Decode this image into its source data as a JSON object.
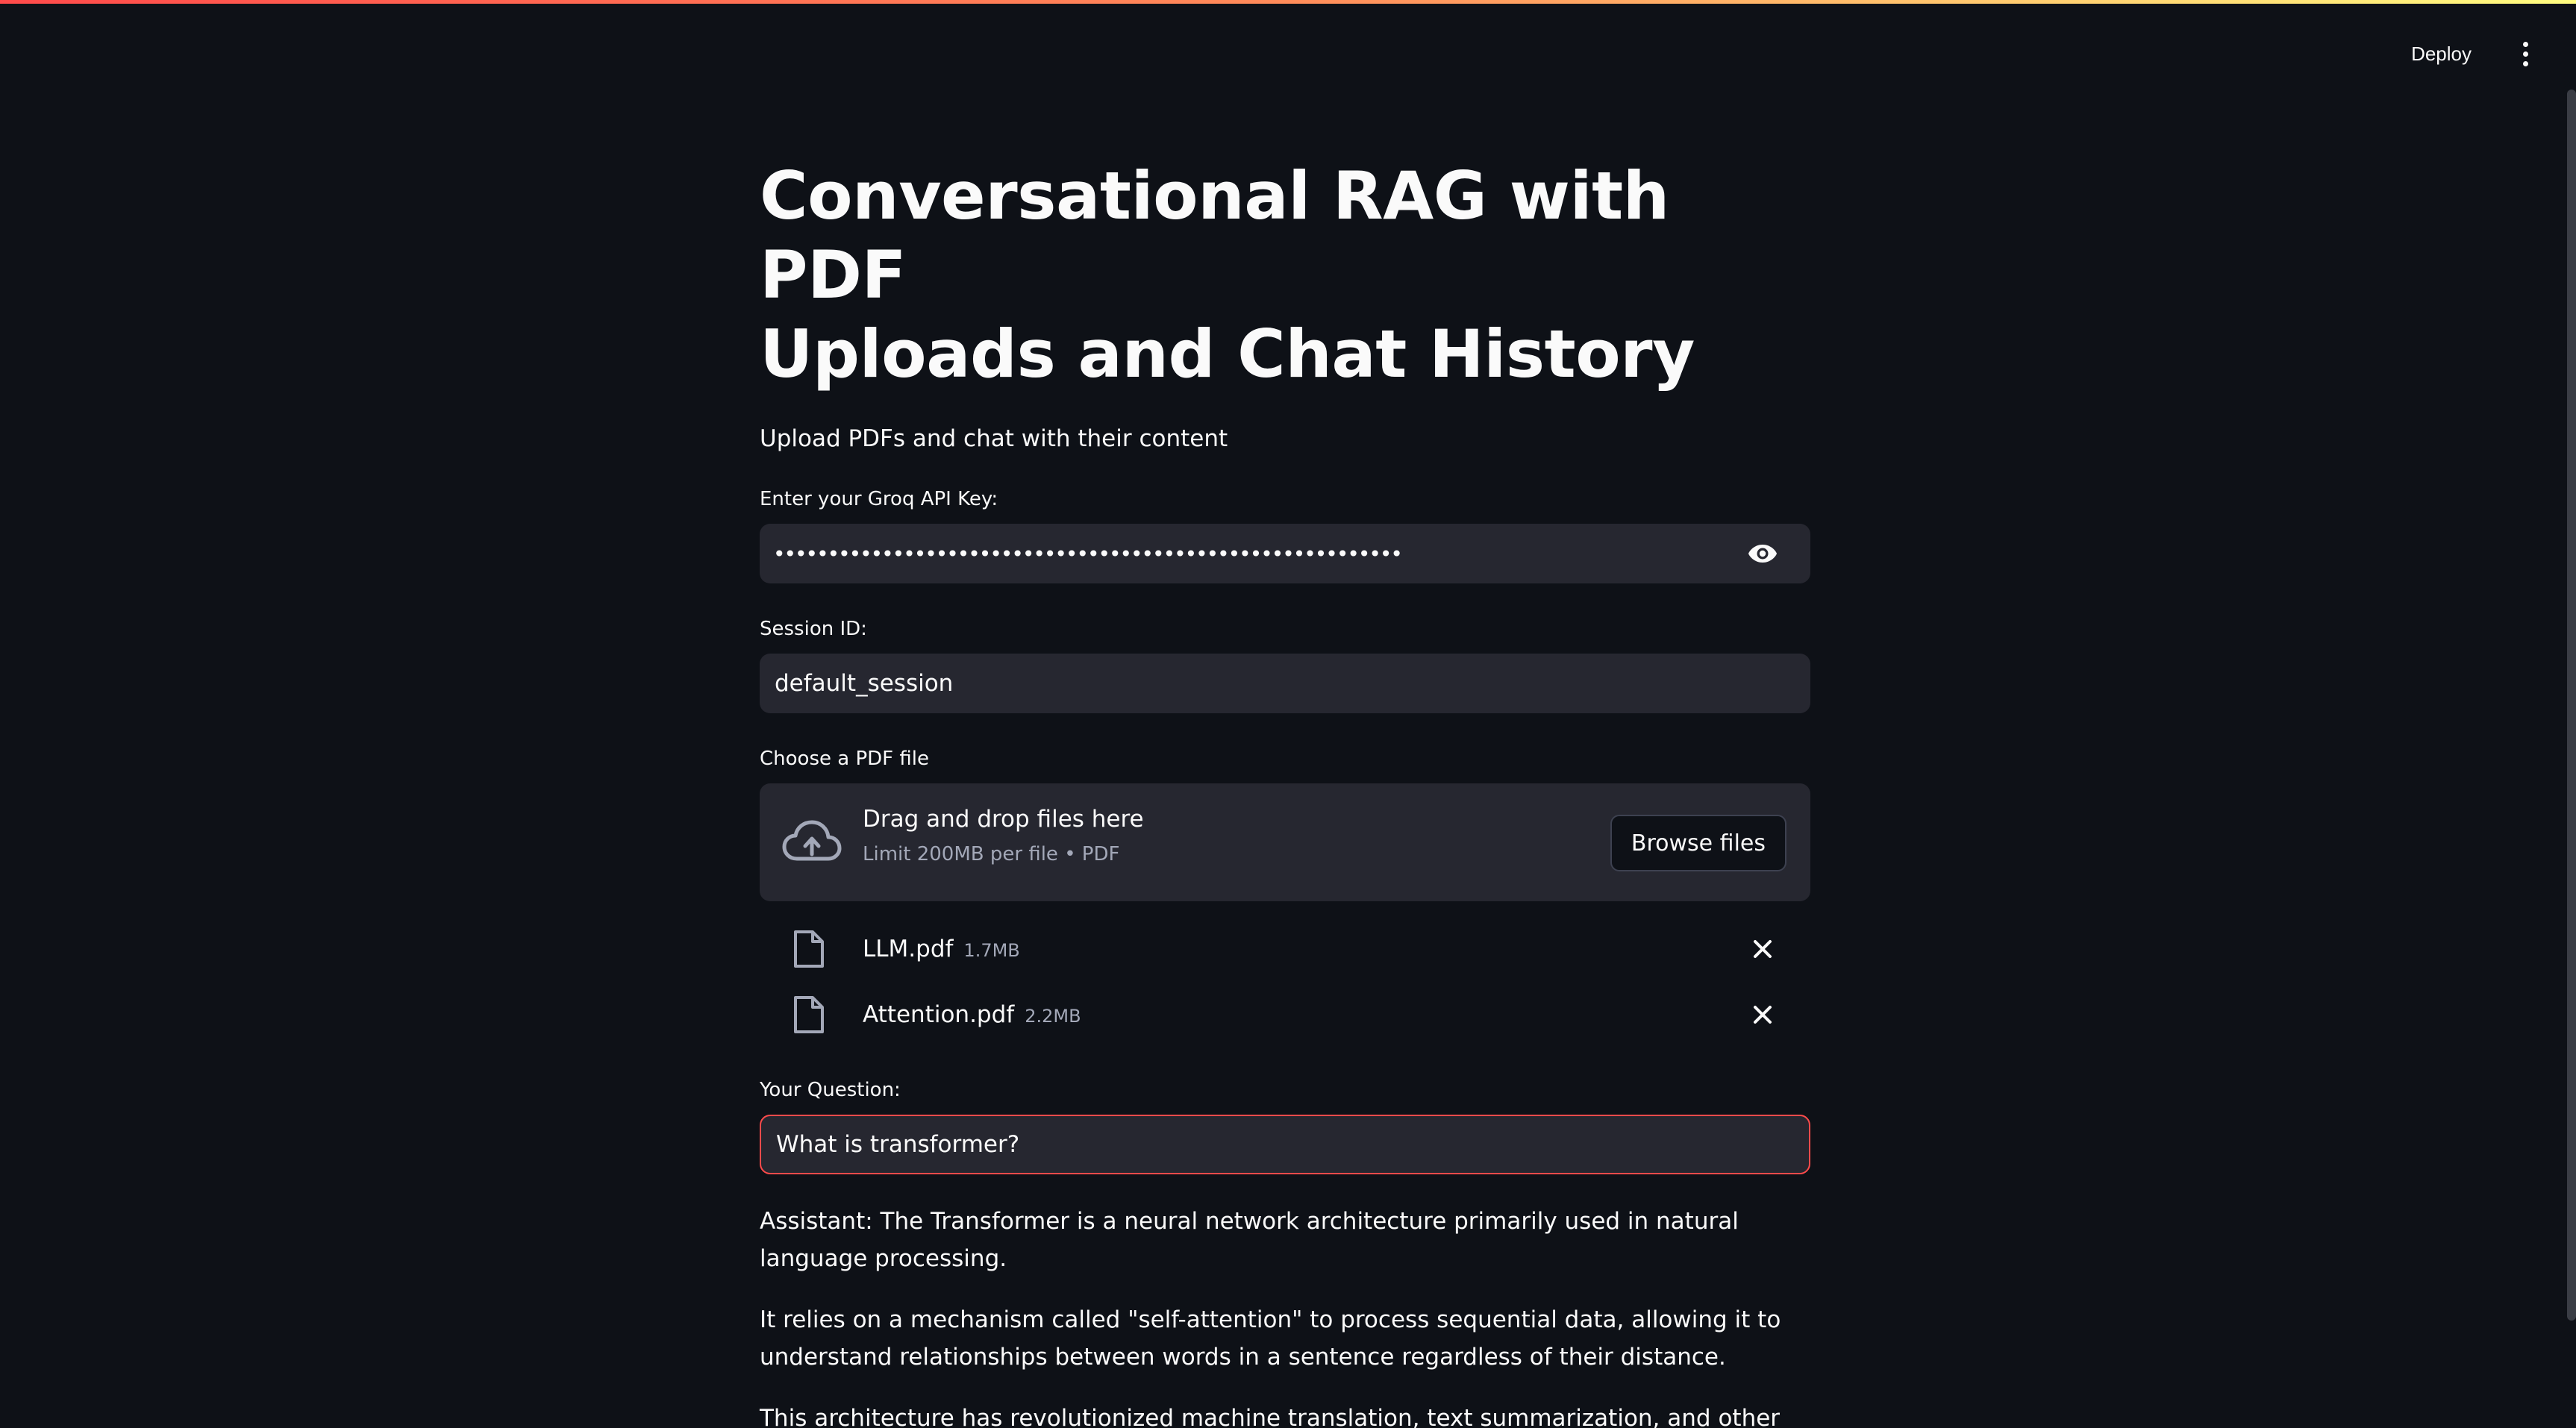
{
  "header": {
    "deploy_label": "Deploy",
    "menu_icon": "more-vertical-icon"
  },
  "page": {
    "title_line1": "Conversational RAG with PDF",
    "title_line2": "Uploads and Chat History",
    "subtitle": "Upload PDFs and chat with their content"
  },
  "api_key": {
    "label": "Enter your Groq API Key:",
    "masked_value": "••••••••••••••••••••••••••••••••••••••••••••••••••••••••••",
    "icon": "eye-icon"
  },
  "session": {
    "label": "Session ID:",
    "value": "default_session"
  },
  "uploader": {
    "label": "Choose a PDF file",
    "drop_text": "Drag and drop files here",
    "limit_text": "Limit 200MB per file • PDF",
    "browse_label": "Browse files",
    "files": [
      {
        "name": "LLM.pdf",
        "size": "1.7MB"
      },
      {
        "name": "Attention.pdf",
        "size": "2.2MB"
      }
    ]
  },
  "question": {
    "label": "Your Question:",
    "value": "What is transformer?"
  },
  "answer": {
    "paragraphs": [
      "Assistant: The Transformer is a neural network architecture primarily used in natural language processing.",
      "It relies on a mechanism called \"self-attention\" to process sequential data, allowing it to understand relationships between words in a sentence regardless of their distance.",
      "This architecture has revolutionized machine translation, text summarization, and other NLP tasks."
    ]
  },
  "colors": {
    "background": "#0e1117",
    "input_bg": "#262730",
    "accent": "#ff4b4b",
    "muted_text": "#a3a8b8"
  }
}
